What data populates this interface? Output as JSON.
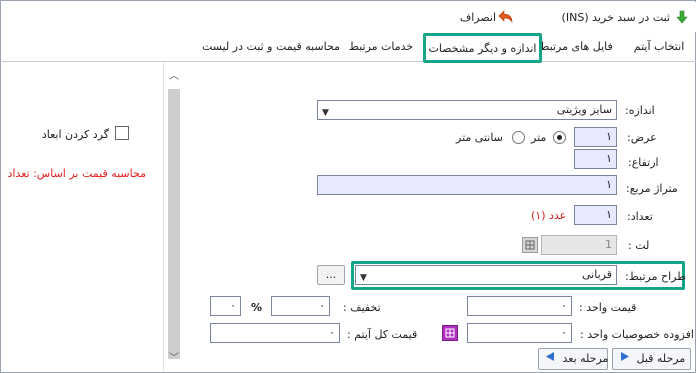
{
  "window": {
    "title": "ثبت در سبد خرید (INS)",
    "cancel_label": "انصراف"
  },
  "tabs": [
    {
      "label": "انتخاب آیتم"
    },
    {
      "label": "فایل های مرتبط"
    },
    {
      "label": "اندازه و دیگر مشخصات"
    },
    {
      "label": "خدمات مرتبط"
    },
    {
      "label": "محاسبه قیمت و ثبت در لیست"
    }
  ],
  "left_panel": {
    "checkbox_label": "گرد کردن ابعاد",
    "calc_text": "محاسبه قیمت بر اساس: تعداد"
  },
  "form": {
    "size_label": "اندازه:",
    "size_value": "سایز ویژیتی",
    "width_label": "عرض:",
    "width_value": "۱",
    "unit_meter": "متر",
    "unit_cm": "سانتی متر",
    "height_label": "ارتفاع:",
    "height_value": "۱",
    "area_label": "متراژ مربع:",
    "area_value": "۱",
    "count_label": "تعداد:",
    "count_value": "۱",
    "count_note": "عدد (۱)",
    "lot_label": "لت :",
    "lot_value": "1",
    "designer_label": "طراح مرتبط:",
    "designer_value": "قربانی",
    "more_button": "...",
    "unit_price_label": "قیمت واحد :",
    "unit_price_value": "۰",
    "discount_label": "تخفیف :",
    "discount_value": "۰",
    "percent_sign": "%",
    "percent_value": "۰",
    "extra_label": "افزوده خصوصیات واحد :",
    "extra_value": "۰",
    "total_label": "قیمت کل آیتم :",
    "total_value": "۰"
  },
  "bottom": {
    "prev_label": "مرحله قبل",
    "next_label": "مرحله بعد"
  },
  "colors": {
    "highlight": "#15a68a",
    "input_bg": "#e8e8ff",
    "red_text": "#d42020"
  }
}
